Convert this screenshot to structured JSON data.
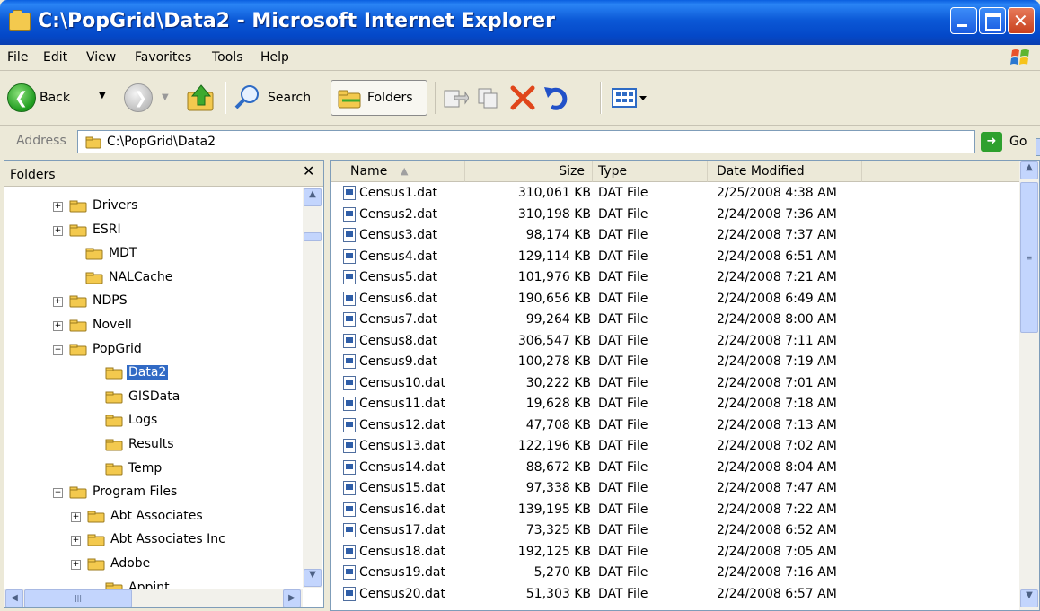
{
  "window": {
    "title": "C:\\PopGrid\\Data2 - Microsoft Internet Explorer"
  },
  "menu": [
    "File",
    "Edit",
    "View",
    "Favorites",
    "Tools",
    "Help"
  ],
  "toolbar": {
    "back": "Back",
    "search": "Search",
    "folders": "Folders"
  },
  "address": {
    "label": "Address",
    "value": "C:\\PopGrid\\Data2",
    "go": "Go"
  },
  "folders_pane": {
    "title": "Folders",
    "tree": [
      {
        "label": "Drivers",
        "expander": "+"
      },
      {
        "label": "ESRI",
        "expander": "+"
      },
      {
        "label": "MDT",
        "expander": ""
      },
      {
        "label": "NALCache",
        "expander": ""
      },
      {
        "label": "NDPS",
        "expander": "+"
      },
      {
        "label": "Novell",
        "expander": "+"
      },
      {
        "label": "PopGrid",
        "expander": "-"
      },
      {
        "label": "Data2",
        "expander": "",
        "selected": true
      },
      {
        "label": "GISData",
        "expander": ""
      },
      {
        "label": "Logs",
        "expander": ""
      },
      {
        "label": "Results",
        "expander": ""
      },
      {
        "label": "Temp",
        "expander": ""
      },
      {
        "label": "Program Files",
        "expander": "-"
      },
      {
        "label": "Abt Associates",
        "expander": "+"
      },
      {
        "label": "Abt Associates Inc",
        "expander": "+"
      },
      {
        "label": "Adobe",
        "expander": "+"
      },
      {
        "label": "Appint",
        "expander": ""
      }
    ]
  },
  "files": {
    "columns": [
      "Name",
      "Size",
      "Type",
      "Date Modified"
    ],
    "rows": [
      [
        "Census1.dat",
        "310,061 KB",
        "DAT File",
        "2/25/2008 4:38 AM"
      ],
      [
        "Census2.dat",
        "310,198 KB",
        "DAT File",
        "2/24/2008 7:36 AM"
      ],
      [
        "Census3.dat",
        "98,174 KB",
        "DAT File",
        "2/24/2008 7:37 AM"
      ],
      [
        "Census4.dat",
        "129,114 KB",
        "DAT File",
        "2/24/2008 6:51 AM"
      ],
      [
        "Census5.dat",
        "101,976 KB",
        "DAT File",
        "2/24/2008 7:21 AM"
      ],
      [
        "Census6.dat",
        "190,656 KB",
        "DAT File",
        "2/24/2008 6:49 AM"
      ],
      [
        "Census7.dat",
        "99,264 KB",
        "DAT File",
        "2/24/2008 8:00 AM"
      ],
      [
        "Census8.dat",
        "306,547 KB",
        "DAT File",
        "2/24/2008 7:11 AM"
      ],
      [
        "Census9.dat",
        "100,278 KB",
        "DAT File",
        "2/24/2008 7:19 AM"
      ],
      [
        "Census10.dat",
        "30,222 KB",
        "DAT File",
        "2/24/2008 7:01 AM"
      ],
      [
        "Census11.dat",
        "19,628 KB",
        "DAT File",
        "2/24/2008 7:18 AM"
      ],
      [
        "Census12.dat",
        "47,708 KB",
        "DAT File",
        "2/24/2008 7:13 AM"
      ],
      [
        "Census13.dat",
        "122,196 KB",
        "DAT File",
        "2/24/2008 7:02 AM"
      ],
      [
        "Census14.dat",
        "88,672 KB",
        "DAT File",
        "2/24/2008 8:04 AM"
      ],
      [
        "Census15.dat",
        "97,338 KB",
        "DAT File",
        "2/24/2008 7:47 AM"
      ],
      [
        "Census16.dat",
        "139,195 KB",
        "DAT File",
        "2/24/2008 7:22 AM"
      ],
      [
        "Census17.dat",
        "73,325 KB",
        "DAT File",
        "2/24/2008 6:52 AM"
      ],
      [
        "Census18.dat",
        "192,125 KB",
        "DAT File",
        "2/24/2008 7:05 AM"
      ],
      [
        "Census19.dat",
        "5,270 KB",
        "DAT File",
        "2/24/2008 7:16 AM"
      ],
      [
        "Census20.dat",
        "51,303 KB",
        "DAT File",
        "2/24/2008 6:57 AM"
      ]
    ]
  },
  "icons": [
    "folder-icon",
    "back-icon",
    "forward-icon",
    "up-icon",
    "search-icon",
    "move-to-icon",
    "copy-to-icon",
    "delete-icon",
    "undo-icon",
    "views-icon",
    "go-icon",
    "dat-file-icon",
    "windows-logo-icon"
  ]
}
